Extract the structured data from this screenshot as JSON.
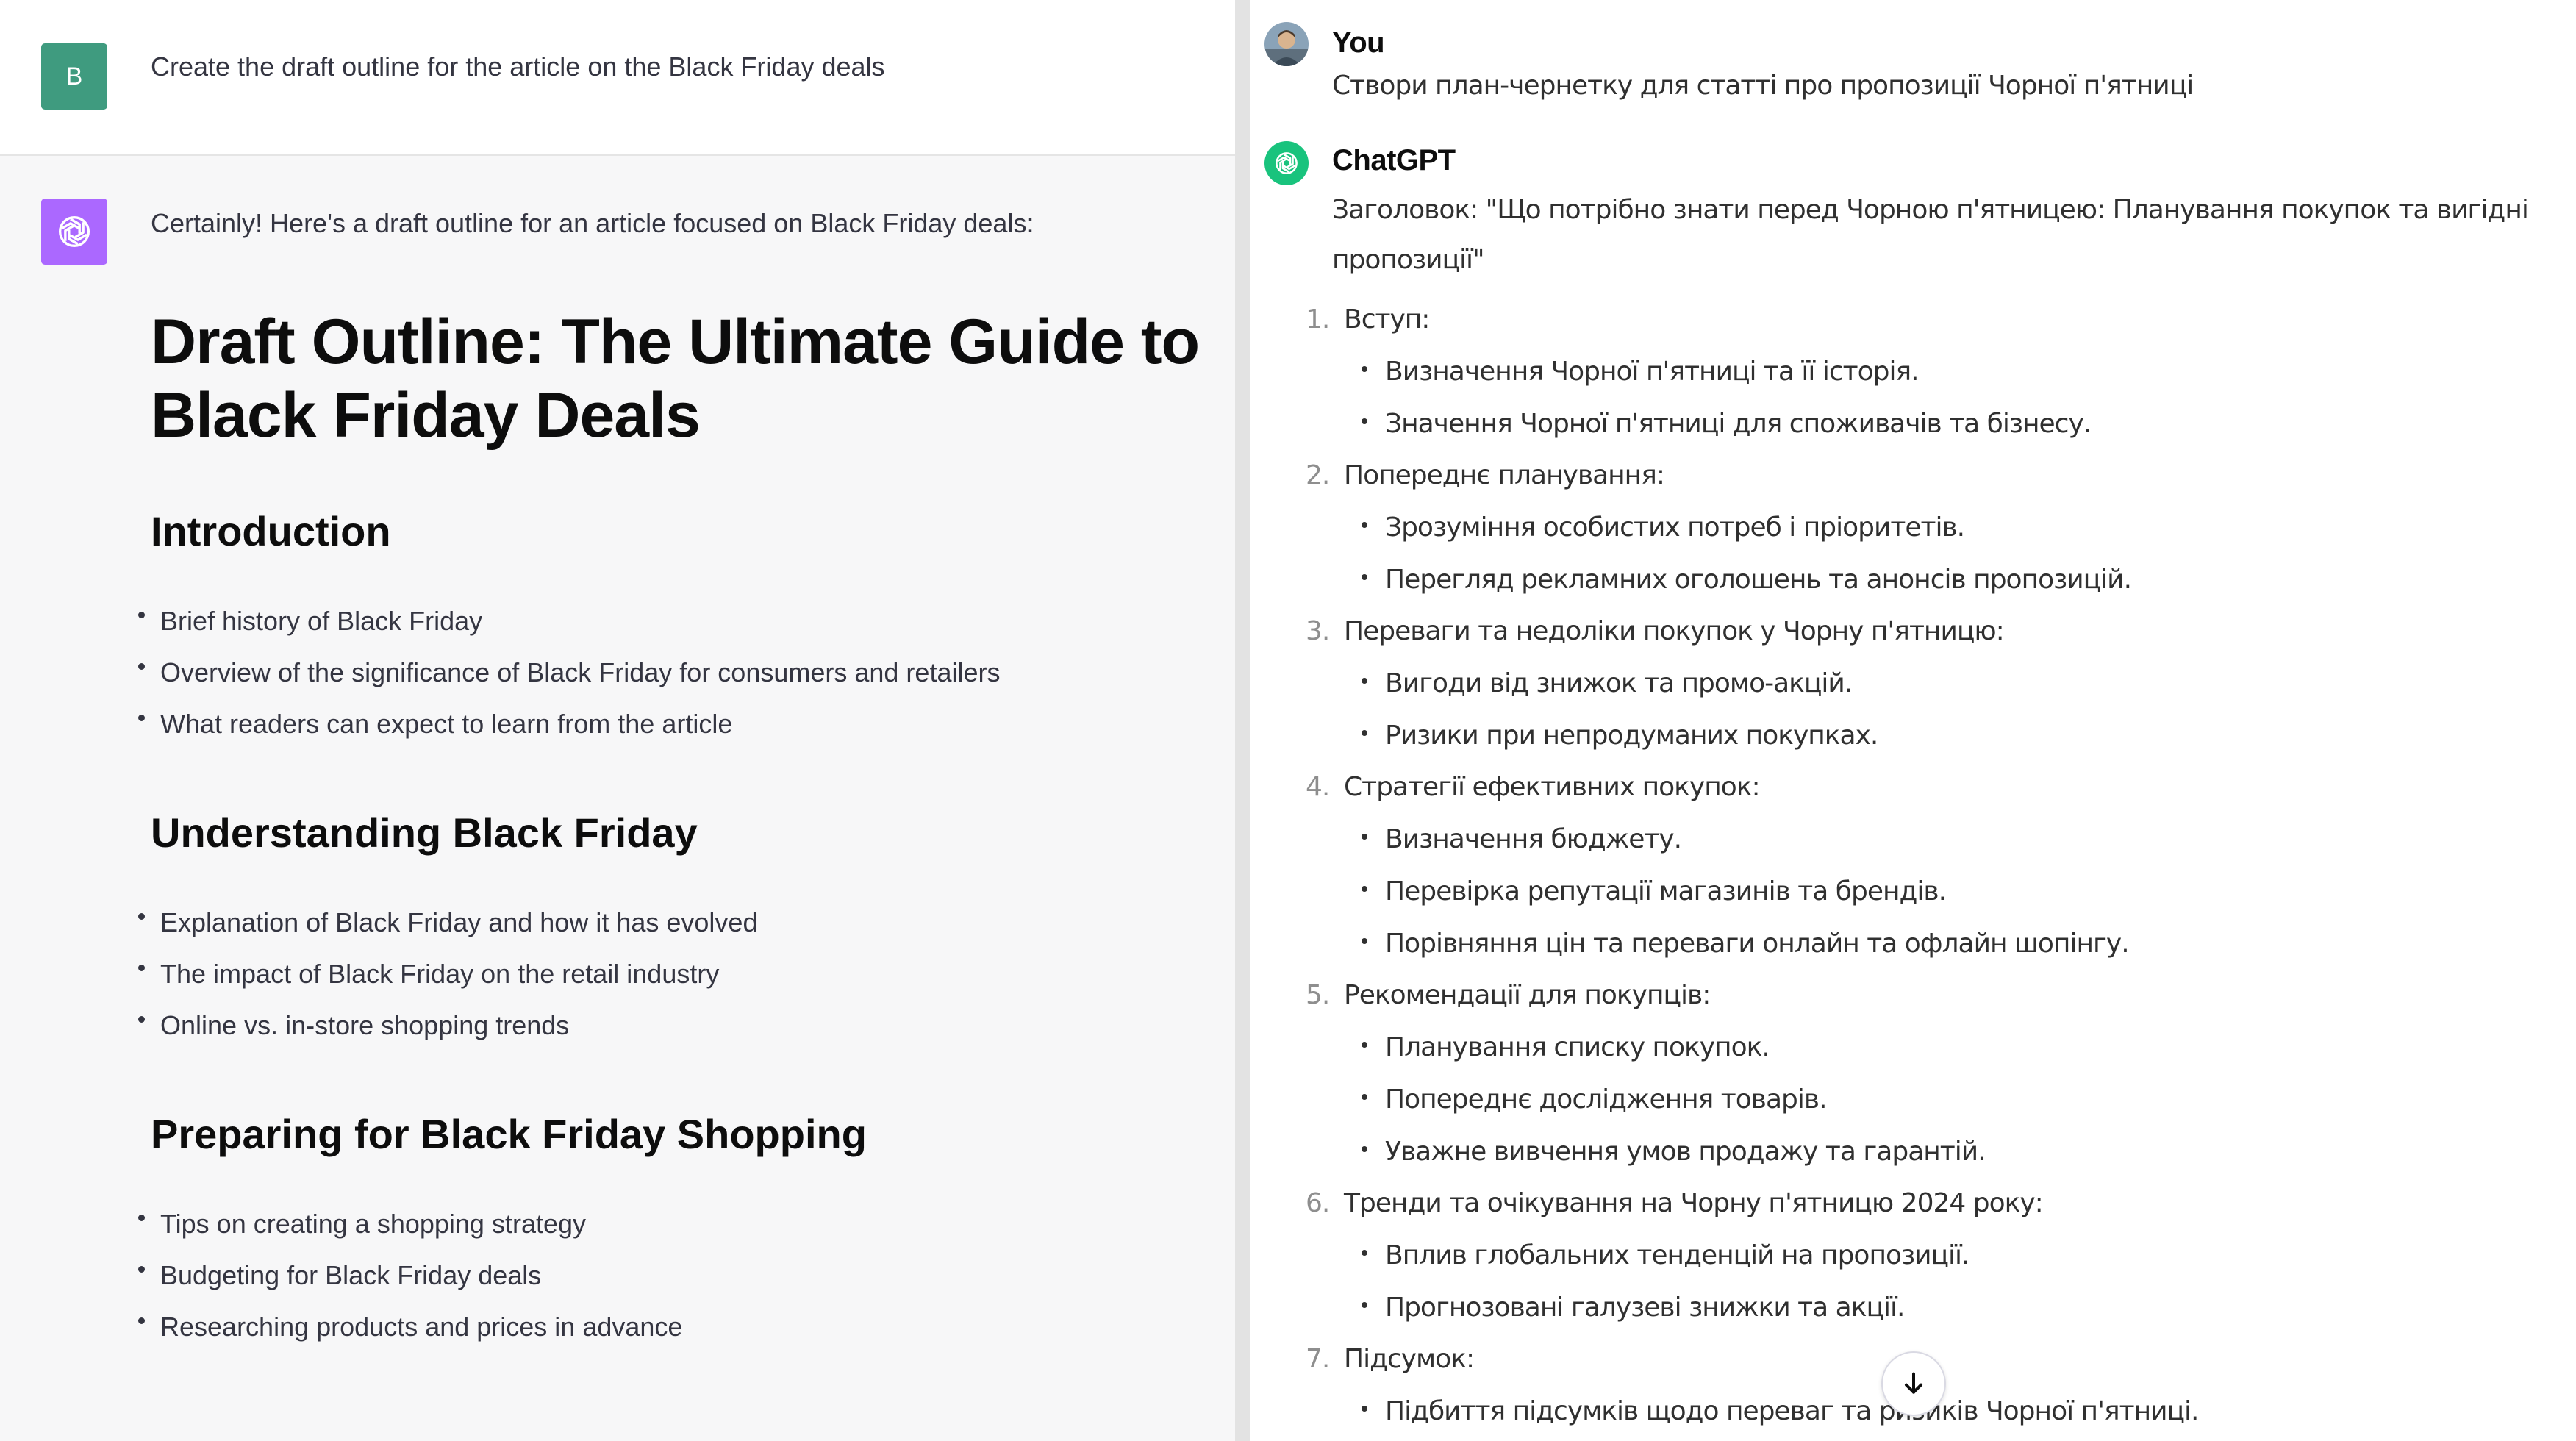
{
  "left": {
    "user": {
      "avatar_letter": "B",
      "avatar_color": "#3f9b7f",
      "prompt": "Create the draft outline for the article on the Black Friday deals"
    },
    "assistant": {
      "avatar_icon": "openai-logo-icon",
      "avatar_color": "#ab68ff",
      "intro": "Certainly! Here's a draft outline for an article focused on Black Friday deals:",
      "title": "Draft Outline: The Ultimate Guide to Black Friday Deals",
      "sections": [
        {
          "heading": "Introduction",
          "items": [
            "Brief history of Black Friday",
            "Overview of the significance of Black Friday for consumers and retailers",
            "What readers can expect to learn from the article"
          ]
        },
        {
          "heading": "Understanding Black Friday",
          "items": [
            "Explanation of Black Friday and how it has evolved",
            "The impact of Black Friday on the retail industry",
            "Online vs. in-store shopping trends"
          ]
        },
        {
          "heading": "Preparing for Black Friday Shopping",
          "items": [
            "Tips on creating a shopping strategy",
            "Budgeting for Black Friday deals",
            "Researching products and prices in advance"
          ]
        }
      ]
    }
  },
  "right": {
    "user": {
      "name": "You",
      "text": "Створи план-чернетку для статті  про пропозиції Чорної п'ятниці"
    },
    "assistant": {
      "name": "ChatGPT",
      "avatar_color": "#19c37d",
      "heading": "Заголовок: \"Що потрібно знати перед Чорною п'ятницею: Планування покупок та вигідні пропозиції\"",
      "outline": [
        {
          "num": "1.",
          "title": "Вступ:",
          "items": [
            "Визначення Чорної п'ятниці та її історія.",
            "Значення Чорної п'ятниці для споживачів та бізнесу."
          ]
        },
        {
          "num": "2.",
          "title": "Попереднє планування:",
          "items": [
            "Зрозуміння особистих потреб і пріоритетів.",
            "Перегляд рекламних оголошень та анонсів пропозицій."
          ]
        },
        {
          "num": "3.",
          "title": "Переваги та недоліки покупок у Чорну п'ятницю:",
          "items": [
            "Вигоди від знижок та промо-акцій.",
            "Ризики при непродуманих покупках."
          ]
        },
        {
          "num": "4.",
          "title": "Стратегії ефективних покупок:",
          "items": [
            "Визначення бюджету.",
            "Перевірка репутації магазинів та брендів.",
            "Порівняння цін та переваги онлайн та офлайн шопінгу."
          ]
        },
        {
          "num": "5.",
          "title": "Рекомендації для покупців:",
          "items": [
            "Планування списку покупок.",
            "Попереднє дослідження товарів.",
            "Уважне вивчення умов продажу та гарантій."
          ]
        },
        {
          "num": "6.",
          "title": "Тренди та очікування на Чорну п'ятницю 2024 року:",
          "items": [
            "Вплив глобальних тенденцій на пропозиції.",
            "Прогнозовані галузеві знижки та акції."
          ]
        },
        {
          "num": "7.",
          "title": "Підсумок:",
          "items": [
            "Підбиття підсумків щодо переваг та ризиків Чорної п'ятниці."
          ]
        }
      ],
      "scroll_button_icon": "arrow-down-icon"
    }
  }
}
